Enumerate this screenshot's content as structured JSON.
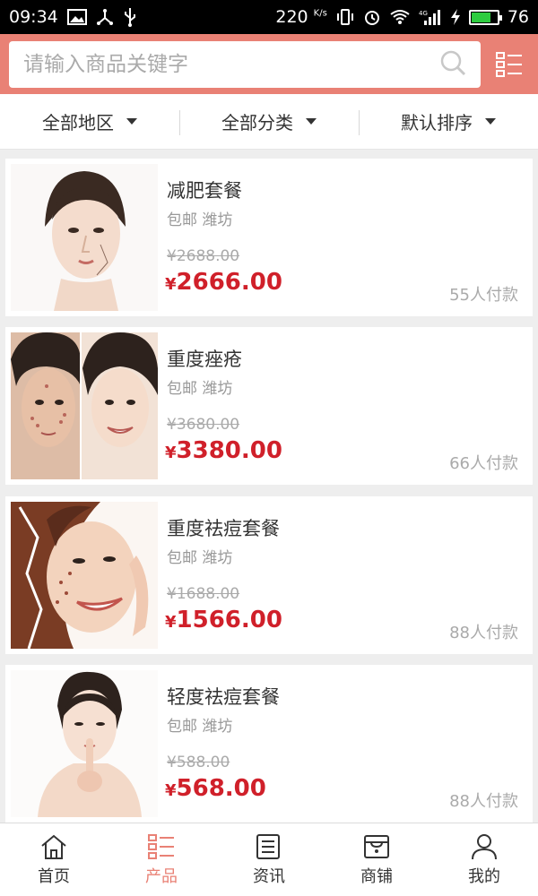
{
  "status_bar": {
    "time": "09:34",
    "net_speed": "220",
    "net_speed_unit": "K/s",
    "battery": "76",
    "battery_level": 0.76,
    "icons": [
      "image-icon",
      "usb-share-icon",
      "usb-icon",
      "vibrate-icon",
      "alarm-icon",
      "wifi-icon",
      "4g-signal-icon",
      "charging-icon",
      "battery-icon"
    ]
  },
  "search": {
    "placeholder": "请输入商品关键字"
  },
  "filters": [
    {
      "label": "全部地区"
    },
    {
      "label": "全部分类"
    },
    {
      "label": "默认排序"
    }
  ],
  "products": [
    {
      "name": "减肥套餐",
      "shipping": "包邮 潍坊",
      "original_price": "¥2688.00",
      "currency": "¥",
      "price": "2666.00",
      "sold": "55人付款"
    },
    {
      "name": "重度痤疮",
      "shipping": "包邮 潍坊",
      "original_price": "¥3680.00",
      "currency": "¥",
      "price": "3380.00",
      "sold": "66人付款"
    },
    {
      "name": "重度祛痘套餐",
      "shipping": "包邮 潍坊",
      "original_price": "¥1688.00",
      "currency": "¥",
      "price": "1566.00",
      "sold": "88人付款"
    },
    {
      "name": "轻度祛痘套餐",
      "shipping": "包邮 潍坊",
      "original_price": "¥588.00",
      "currency": "¥",
      "price": "568.00",
      "sold": "88人付款"
    }
  ],
  "nav": [
    {
      "label": "首页",
      "icon": "home-icon"
    },
    {
      "label": "产品",
      "icon": "list-icon",
      "active": true
    },
    {
      "label": "资讯",
      "icon": "news-icon"
    },
    {
      "label": "商铺",
      "icon": "shop-icon"
    },
    {
      "label": "我的",
      "icon": "user-icon"
    }
  ],
  "colors": {
    "accent": "#e98175",
    "price": "#d0202a",
    "muted": "#999999"
  }
}
